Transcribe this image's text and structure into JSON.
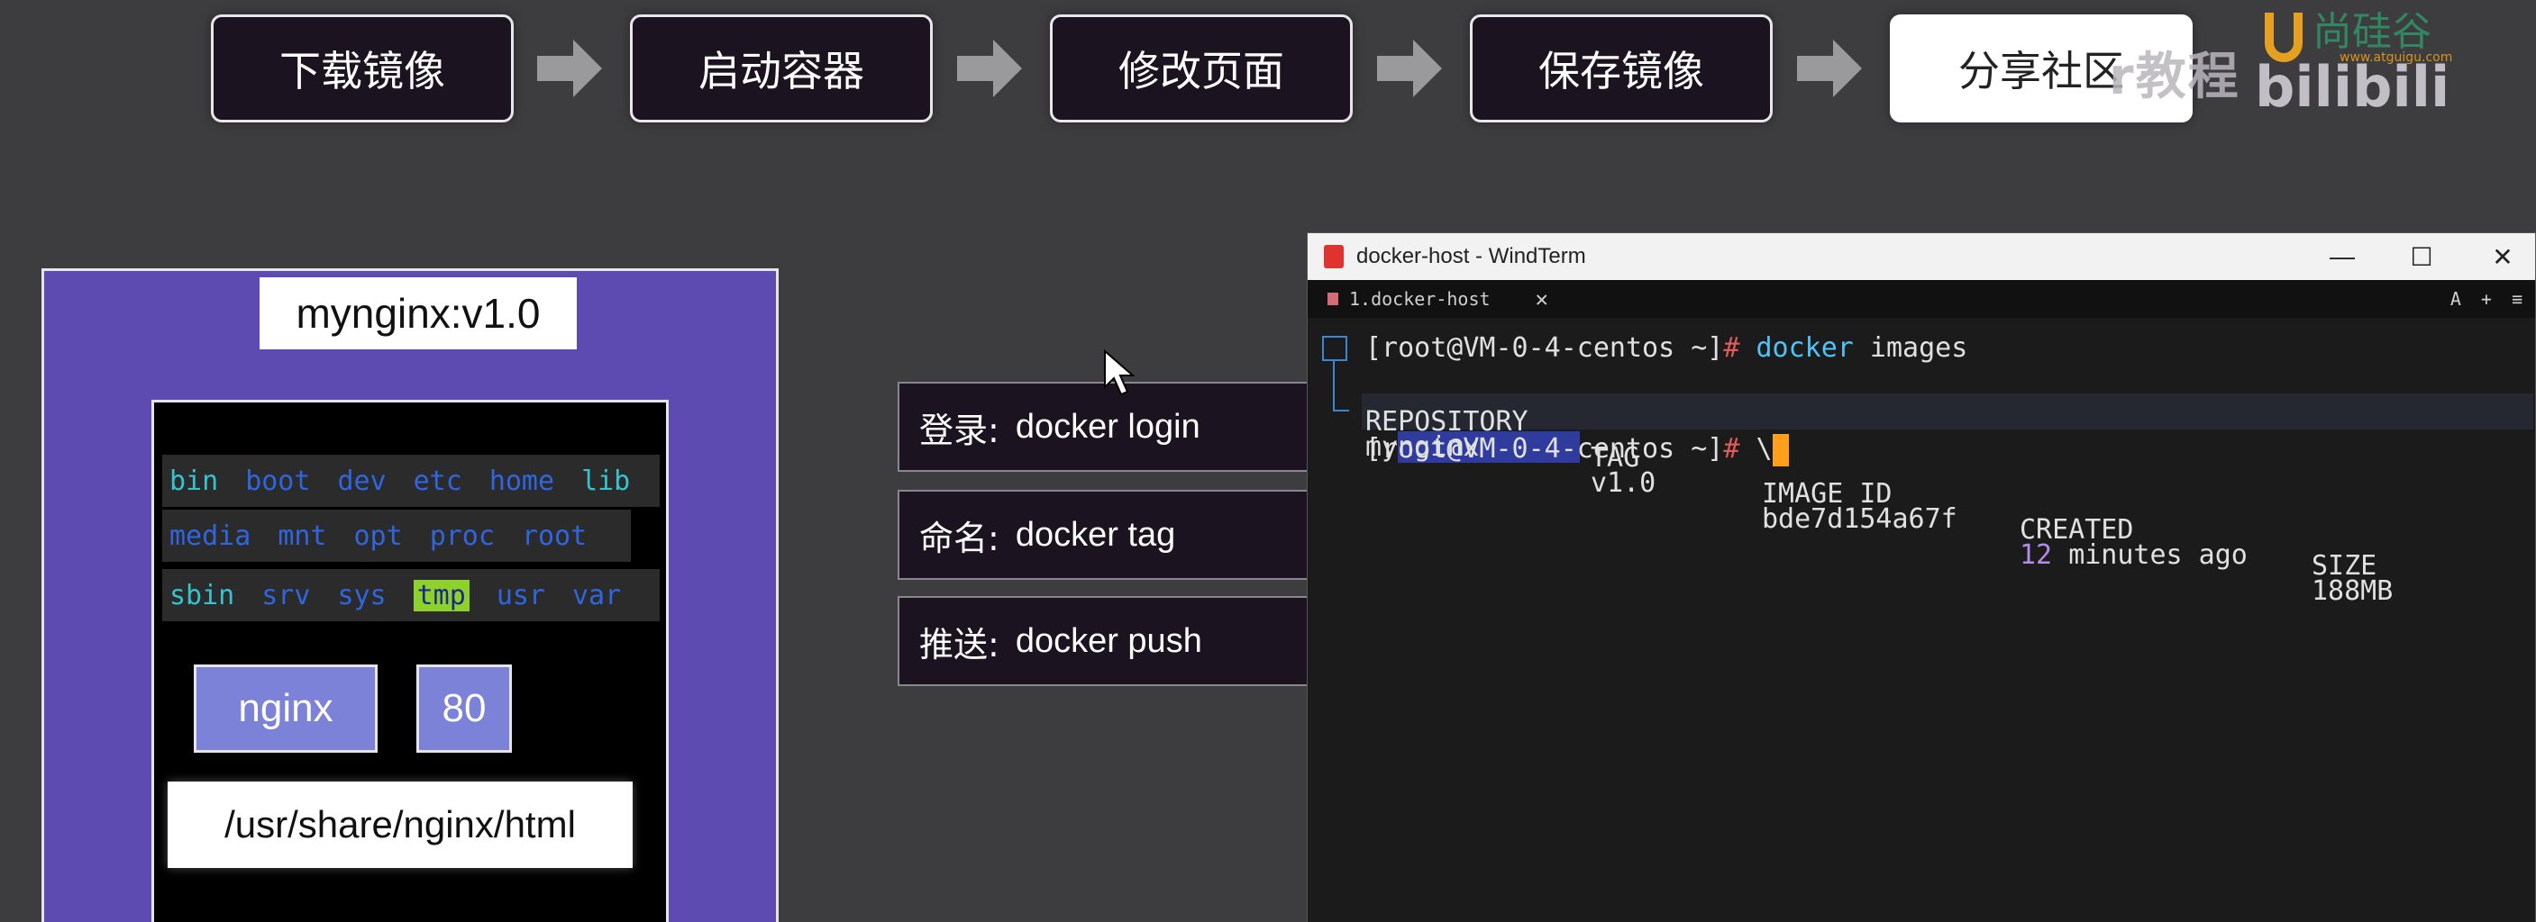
{
  "workflow": {
    "steps": [
      "下载镜像",
      "启动容器",
      "修改页面",
      "保存镜像",
      "分享社区"
    ],
    "active_index": 4
  },
  "watermark": {
    "text": "r教程",
    "site": "www.atguigu.com",
    "brand_logo": "bilibili-logo",
    "org_icon": "atguigu-logo"
  },
  "diagram": {
    "image_label": "mynginx:v1.0",
    "fs_rows": [
      [
        "bin",
        "boot",
        "dev",
        "etc",
        "home",
        "lib"
      ],
      [
        "media",
        "mnt",
        "opt",
        "proc",
        "root"
      ],
      [
        "sbin",
        "srv",
        "sys",
        "tmp",
        "usr",
        "var"
      ]
    ],
    "app_name": "nginx",
    "port": "80",
    "html_path": "/usr/share/nginx/html"
  },
  "commands": [
    {
      "label": "登录:",
      "cmd": "docker login"
    },
    {
      "label": "命名:",
      "cmd": "docker tag"
    },
    {
      "label": "推送:",
      "cmd": "docker push"
    }
  ],
  "terminal": {
    "window_title": "docker-host - WindTerm",
    "tab_label": "1.docker-host",
    "tab_close": "✕",
    "tab_icons": [
      "A",
      "+",
      "≡"
    ],
    "prompt1": "[root@VM-0-4-centos ~]",
    "hash": "#",
    "command1_cmd": "docker",
    "command1_arg": "images",
    "header": {
      "repository": "REPOSITORY",
      "tag": "TAG",
      "image_id": "IMAGE ID",
      "created": "CREATED",
      "size": "SIZE"
    },
    "row": {
      "repository_prefix": "my",
      "repository_selected": "nginx",
      "tag": "v1.0",
      "image_id": "bde7d154a67f",
      "created_num": "12",
      "created_rest": "minutes ago",
      "size": "188MB"
    },
    "prompt2": "[root@VM-0-4-centos ~]",
    "input2": "\\"
  },
  "colors": {
    "background": "#3d3d3f",
    "step_bg": "#1c1320",
    "image_frame": "#5d4bb1",
    "port_box": "#7b82d8",
    "cursor": "#ff9f1a"
  }
}
